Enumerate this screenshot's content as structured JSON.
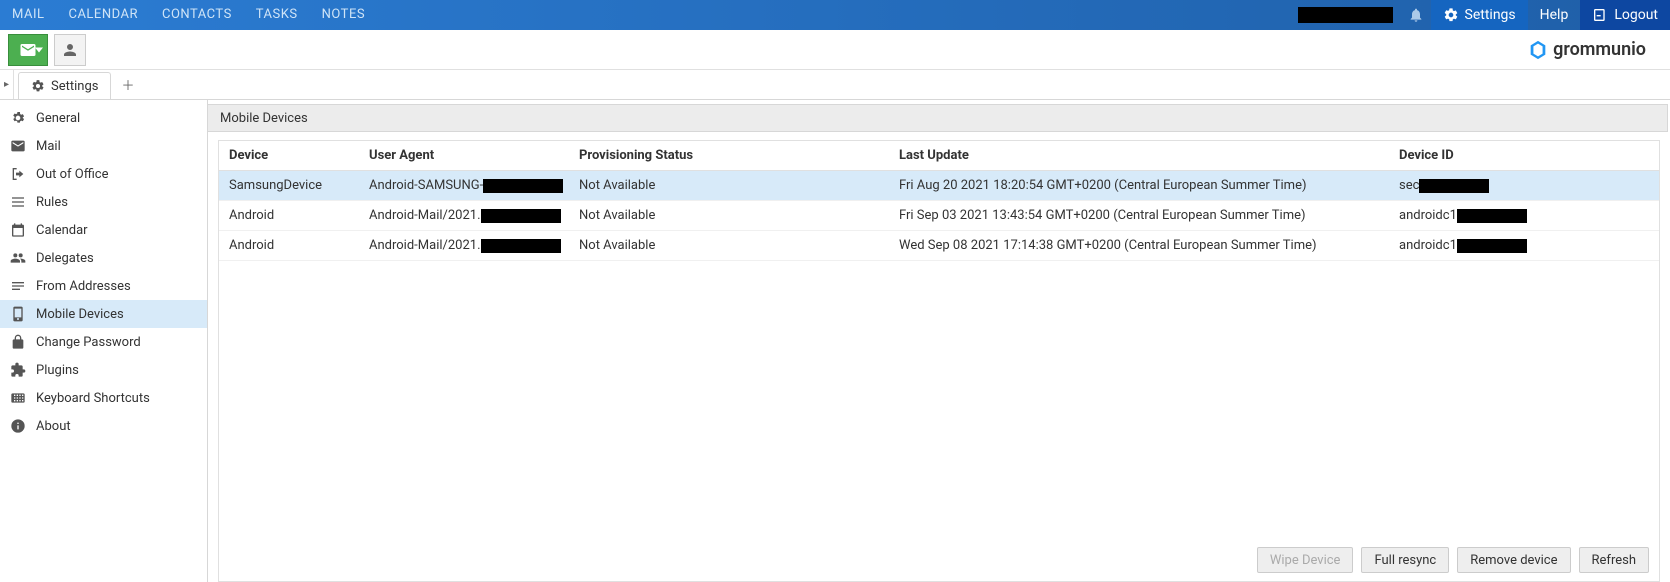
{
  "topnav": {
    "items": [
      "MAIL",
      "CALENDAR",
      "CONTACTS",
      "TASKS",
      "NOTES"
    ],
    "settings": "Settings",
    "help": "Help",
    "logout": "Logout"
  },
  "brand": "grommunio",
  "tab": {
    "label": "Settings"
  },
  "sidebar": {
    "items": [
      {
        "label": "General",
        "icon": "gear-icon"
      },
      {
        "label": "Mail",
        "icon": "mail-icon"
      },
      {
        "label": "Out of Office",
        "icon": "exit-icon"
      },
      {
        "label": "Rules",
        "icon": "rules-icon"
      },
      {
        "label": "Calendar",
        "icon": "calendar-icon"
      },
      {
        "label": "Delegates",
        "icon": "delegates-icon"
      },
      {
        "label": "From Addresses",
        "icon": "from-icon"
      },
      {
        "label": "Mobile Devices",
        "icon": "mobile-icon"
      },
      {
        "label": "Change Password",
        "icon": "lock-icon"
      },
      {
        "label": "Plugins",
        "icon": "puzzle-icon"
      },
      {
        "label": "Keyboard Shortcuts",
        "icon": "keyboard-icon"
      },
      {
        "label": "About",
        "icon": "info-icon"
      }
    ],
    "selected_index": 7
  },
  "panel": {
    "title": "Mobile Devices"
  },
  "table": {
    "columns": [
      "Device",
      "User Agent",
      "Provisioning Status",
      "Last Update",
      "Device ID"
    ],
    "rows": [
      {
        "device": "SamsungDevice",
        "ua_prefix": "Android-SAMSUNG-",
        "ua_redacted": true,
        "prov": "Not Available",
        "updated": "Fri Aug 20 2021 18:20:54 GMT+0200 (Central European Summer Time)",
        "id_prefix": "sec",
        "id_redacted": true,
        "selected": true
      },
      {
        "device": "Android",
        "ua_prefix": "Android-Mail/2021.",
        "ua_redacted": true,
        "prov": "Not Available",
        "updated": "Fri Sep 03 2021 13:43:54 GMT+0200 (Central European Summer Time)",
        "id_prefix": "androidc1",
        "id_redacted": true,
        "selected": false
      },
      {
        "device": "Android",
        "ua_prefix": "Android-Mail/2021.",
        "ua_redacted": true,
        "prov": "Not Available",
        "updated": "Wed Sep 08 2021 17:14:38 GMT+0200 (Central European Summer Time)",
        "id_prefix": "androidc1",
        "id_redacted": true,
        "selected": false
      }
    ]
  },
  "buttons": {
    "wipe": "Wipe Device",
    "resync": "Full resync",
    "remove": "Remove device",
    "refresh": "Refresh"
  }
}
